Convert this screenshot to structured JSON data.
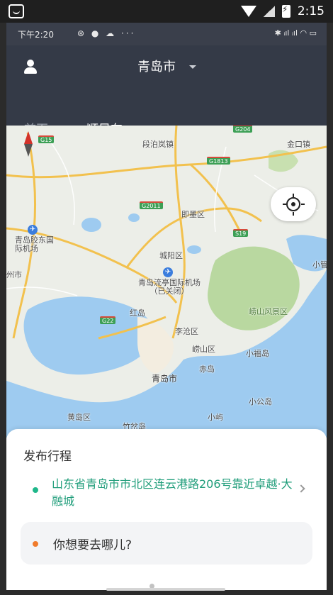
{
  "system_bar": {
    "time": "2:15"
  },
  "inner_status": {
    "time": "下午2:20",
    "icons": "⊛ ● ☁ ···",
    "right_icons": "✱ ᵢıl ᵢıl ◠ ▭"
  },
  "header": {
    "city": "青岛市",
    "tabs": [
      {
        "label": "首页",
        "active": false
      },
      {
        "label": "顺风车",
        "active": true
      }
    ],
    "accent": "#1fb78a"
  },
  "map": {
    "labels": [
      "段泊岚镇",
      "金口镇",
      "即墨区",
      "青岛胶东国际机场",
      "城阳区",
      "青岛流亭国际机场（已关闭）",
      "崂山风景区",
      "李沧区",
      "红岛",
      "崂山区",
      "小福岛",
      "青岛市",
      "赤岛",
      "小公岛",
      "黄岛区",
      "竹岔岛",
      "小屿",
      "小管",
      "州市"
    ],
    "road_badges": [
      "G204",
      "G15",
      "G1813",
      "G2011",
      "S19",
      "G22"
    ]
  },
  "trip_card": {
    "title": "发布行程",
    "origin": "山东省青岛市市北区连云港路206号靠近卓越·大融城",
    "destination_placeholder": "你想要去哪儿?"
  }
}
